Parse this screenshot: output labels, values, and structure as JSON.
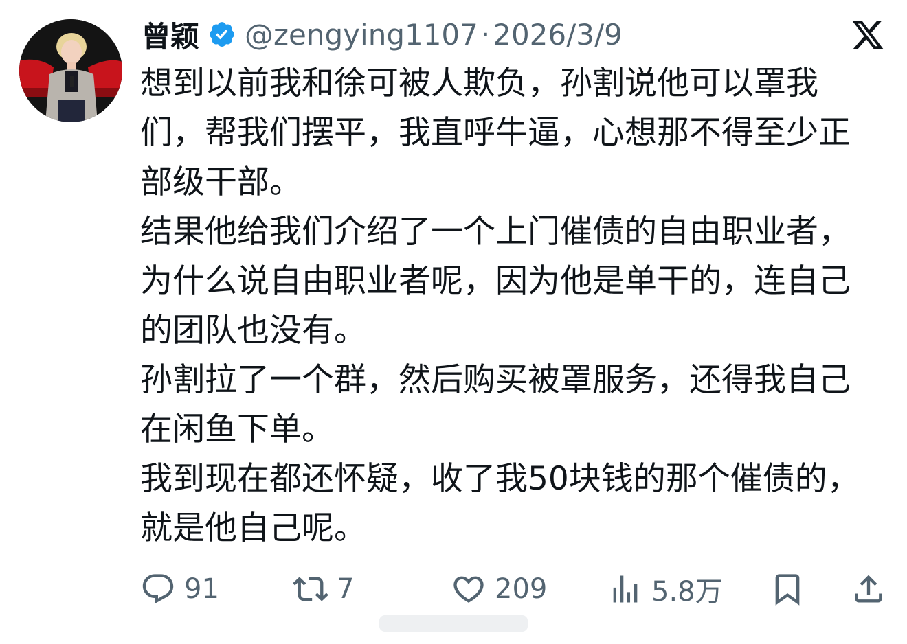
{
  "author": {
    "display_name": "曾颖",
    "handle": "@zengying1107",
    "separator": "·",
    "date": "2026/3/9"
  },
  "tweet": {
    "paragraphs": [
      "想到以前我和徐可被人欺负，孙割说他可以罩我们，帮我们摆平，我直呼牛逼，心想那不得至少正部级干部。",
      "结果他给我们介绍了一个上门催债的自由职业者，为什么说自由职业者呢，因为他是单干的，连自己的团队也没有。",
      "孙割拉了一个群，然后购买被罩服务，还得我自己在闲鱼下单。",
      "我到现在都还怀疑，收了我50块钱的那个催债的，就是他自己呢。"
    ]
  },
  "actions": {
    "replies": "91",
    "retweets": "7",
    "likes": "209",
    "views": "5.8万"
  },
  "icons": {
    "verified": "verified-badge-icon",
    "platform": "x-logo-icon",
    "reply": "reply-icon",
    "retweet": "retweet-icon",
    "like": "heart-icon",
    "views": "views-chart-icon",
    "bookmark": "bookmark-icon",
    "share": "share-icon"
  },
  "colors": {
    "text": "#0f1419",
    "secondary": "#536471",
    "verified": "#1d9bf0"
  }
}
